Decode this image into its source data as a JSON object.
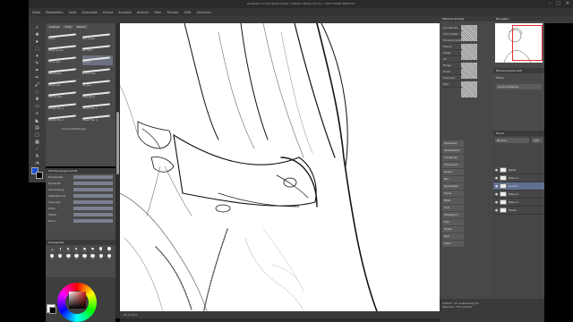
{
  "title_bar": {
    "text": "Illustration 2.clip* [Rest] (2000 x 2500px 350dpi 53.2%) - CLIP STUDIO PAINT EX"
  },
  "menu": {
    "items": [
      "Datei",
      "Bearbeiten",
      "Seite",
      "Animation",
      "Ebene",
      "Auswahl",
      "Ansicht",
      "Filter",
      "Fenster",
      "Hilfe",
      "Zeichnen"
    ]
  },
  "window_controls": {
    "minimize": "–",
    "maximize": "□",
    "close": "✕"
  },
  "brush_panel": {
    "tabs": [
      "Gsänge",
      "Tinte",
      "Marker"
    ],
    "brushes": [
      {
        "name": "G-pen",
        "selected": false
      },
      {
        "name": "Real G-pen",
        "selected": false
      },
      {
        "name": "Mapping pen",
        "selected": false
      },
      {
        "name": "Pen Hard",
        "selected": false
      },
      {
        "name": "Turnip pen",
        "selected": false
      },
      {
        "name": "Ink Pen",
        "selected": true
      },
      {
        "name": "Kabura pen",
        "selected": false
      },
      {
        "name": "Scratch pen",
        "selected": false
      },
      {
        "name": "Rough pen",
        "selected": false
      },
      {
        "name": "Dip pen",
        "selected": false
      },
      {
        "name": "Smooth pen",
        "selected": false
      },
      {
        "name": "Calligraphy",
        "selected": false
      },
      {
        "name": "Lineart Pen 1",
        "selected": false
      },
      {
        "name": "Lineart Pen 2",
        "selected": false
      },
      {
        "name": "Lineart Pen 3",
        "selected": false
      },
      {
        "name": "Lineart Pen 4",
        "selected": false
      }
    ],
    "sub_tool_settings": "Sub Toolhilfslinger"
  },
  "tool_properties": {
    "header": "Werkzeugeigenschaft",
    "rows": [
      {
        "label": "Pinselgröße"
      },
      {
        "label": "Deckkraft"
      },
      {
        "label": "Anti-aliasing"
      },
      {
        "label": "Stabilisierung"
      },
      {
        "label": "Verjüngen"
      },
      {
        "label": "Farbe"
      },
      {
        "label": "Stärke"
      },
      {
        "label": "Dicke"
      }
    ]
  },
  "brush_size": {
    "header": "Pinselgröße",
    "sizes": [
      "0.7",
      "1",
      "1.5",
      "2",
      "2.5",
      "3",
      "4",
      "5",
      "6",
      "7",
      "8",
      "10",
      "12",
      "15",
      "17",
      "20"
    ]
  },
  "canvas": {
    "status": "53.2  0.0  0"
  },
  "material_panel": {
    "header": "Material [Pinsel]",
    "list": [
      "All materials",
      "Color pattern",
      "Monochromatic",
      "Texture",
      "Image",
      "3D",
      "Manga",
      "Brush",
      "Download",
      "Pose"
    ],
    "buttons": [
      "Downloads",
      "Verlaufskarte",
      "Schraffuren",
      "Farbverlauf",
      "Muster",
      "Bild",
      "Sprechblase",
      "Frame",
      "Effekt",
      "Linie",
      "Hintergrund",
      "Figur",
      "Objekt",
      "Pose",
      "Szene"
    ]
  },
  "navigator": {
    "header": "Navigator"
  },
  "layer_properties": {
    "header": "Ebeneneigenschaft",
    "effect": "Effekt",
    "expression_color": "Ausdrucksfarbe"
  },
  "layers": {
    "header": "Ebene",
    "blend_mode": "Normal",
    "opacity": "100",
    "items": [
      {
        "name": "Papier",
        "selected": false
      },
      {
        "name": "Ebene 1",
        "selected": false
      },
      {
        "name": "Lineart",
        "selected": true
      },
      {
        "name": "Ebene 2",
        "selected": false
      },
      {
        "name": "Ebene 3",
        "selected": false
      },
      {
        "name": "Skizze",
        "selected": false
      }
    ]
  },
  "bottom_right": {
    "line1": "System:  0% Auslastung  0%",
    "line2": "Speicher:  74%  Verlauf"
  }
}
